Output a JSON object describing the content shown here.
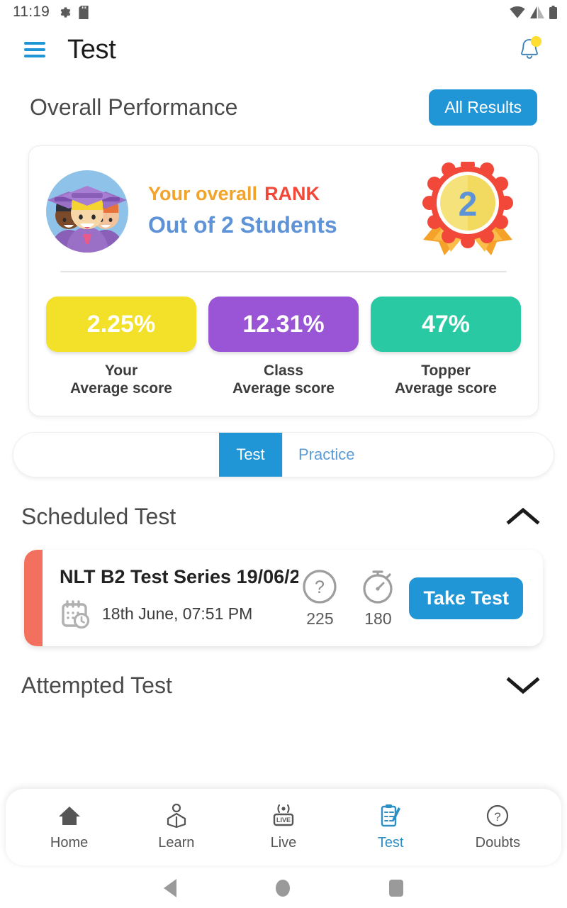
{
  "statusbar": {
    "time": "11:19",
    "icons": [
      "gear-icon",
      "sdcard-icon",
      "wifi-icon",
      "signal-icon",
      "battery-icon"
    ]
  },
  "appbar": {
    "menu_icon": "hamburger-menu-icon",
    "title": "Test",
    "notification_icon": "bell-icon",
    "menu_color": "#2196d6"
  },
  "overall": {
    "section_title": "Overall Performance",
    "all_results_label": "All Results",
    "accent_color": "#2196d6"
  },
  "rank": {
    "avatar_icon": "graduates-avatar",
    "label_prefix": "Your overall",
    "label_rank": "RANK",
    "out_of": "Out of 2 Students",
    "badge_icon": "rosette-badge-icon",
    "badge_value": "2",
    "prefix_color": "#f2a329",
    "rank_color": "#f2483a",
    "outof_color": "#5e93d8"
  },
  "scores": [
    {
      "value": "2.25%",
      "caption_line1": "Your",
      "caption_line2": "Average score",
      "color": "#f2e029"
    },
    {
      "value": "12.31%",
      "caption_line1": "Class",
      "caption_line2": "Average score",
      "color": "#9a55d6"
    },
    {
      "value": "47%",
      "caption_line1": "Topper",
      "caption_line2": "Average score",
      "color": "#29c9a4"
    }
  ],
  "tabs": [
    {
      "label": "Test",
      "active": true
    },
    {
      "label": "Practice",
      "active": false
    }
  ],
  "scheduled": {
    "title": "Scheduled Test",
    "chevron_icon": "chevron-up-icon",
    "expanded": true,
    "items": [
      {
        "name": "NLT B2 Test Series 19/06/2...",
        "calendar_icon": "calendar-clock-icon",
        "date": "18th June, 07:51 PM",
        "questions_icon": "question-mark-circle-icon",
        "questions": "225",
        "duration_icon": "stopwatch-icon",
        "duration": "180",
        "action_label": "Take Test",
        "accent_color": "#f4705e"
      }
    ]
  },
  "attempted": {
    "title": "Attempted Test",
    "chevron_icon": "chevron-down-icon",
    "expanded": false
  },
  "bottomnav": {
    "items": [
      {
        "label": "Home",
        "icon": "home-icon",
        "active": false
      },
      {
        "label": "Learn",
        "icon": "reading-icon",
        "active": false
      },
      {
        "label": "Live",
        "icon": "live-icon",
        "active": false
      },
      {
        "label": "Test",
        "icon": "clipboard-pen-icon",
        "active": true
      },
      {
        "label": "Doubts",
        "icon": "question-circle-icon",
        "active": false
      }
    ],
    "active_color": "#2e8fc4"
  },
  "sysnav": {
    "back_icon": "triangle-back-icon",
    "home_icon": "circle-home-icon",
    "recent_icon": "square-recents-icon"
  }
}
